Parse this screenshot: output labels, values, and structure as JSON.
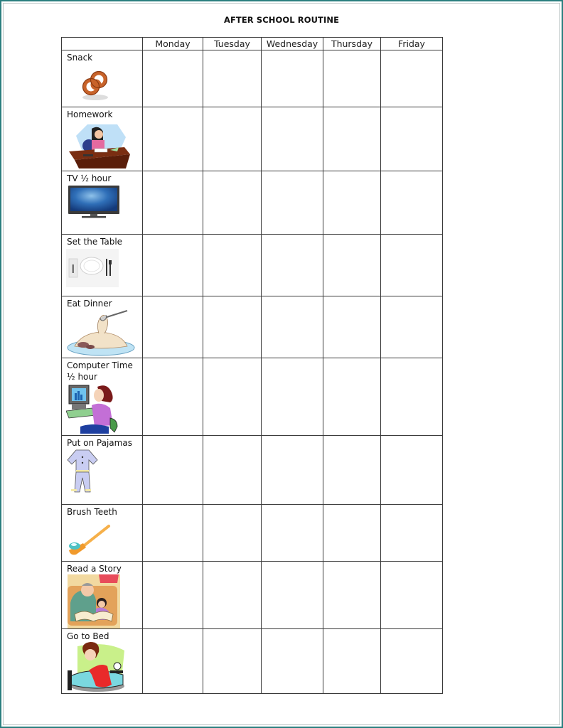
{
  "title": "AFTER SCHOOL ROUTINE",
  "colors": {
    "frame": "#2a7f7f",
    "grid": "#3a3a3a",
    "text": "#111111"
  },
  "header": {
    "corner": "",
    "days": [
      "Monday",
      "Tuesday",
      "Wednesday",
      "Thursday",
      "Friday"
    ]
  },
  "tasks": [
    {
      "label": "Snack",
      "icon": "pretzel-icon",
      "checks": [
        "",
        "",
        "",
        "",
        ""
      ]
    },
    {
      "label": "Homework",
      "icon": "student-at-desk-icon",
      "checks": [
        "",
        "",
        "",
        "",
        ""
      ]
    },
    {
      "label": "TV ½ hour",
      "icon": "television-icon",
      "checks": [
        "",
        "",
        "",
        "",
        ""
      ]
    },
    {
      "label": "Set the Table",
      "icon": "place-setting-icon",
      "checks": [
        "",
        "",
        "",
        "",
        ""
      ]
    },
    {
      "label": "Eat Dinner",
      "icon": "spaghetti-plate-icon",
      "checks": [
        "",
        "",
        "",
        "",
        ""
      ]
    },
    {
      "label": "Computer Time ½ hour",
      "icon": "girl-at-computer-icon",
      "checks": [
        "",
        "",
        "",
        "",
        ""
      ]
    },
    {
      "label": "Put on Pajamas",
      "icon": "pajamas-icon",
      "checks": [
        "",
        "",
        "",
        "",
        ""
      ]
    },
    {
      "label": "Brush Teeth",
      "icon": "toothbrush-icon",
      "checks": [
        "",
        "",
        "",
        "",
        ""
      ]
    },
    {
      "label": "Read a Story",
      "icon": "grandpa-reading-icon",
      "checks": [
        "",
        "",
        "",
        "",
        ""
      ]
    },
    {
      "label": "Go to Bed",
      "icon": "woman-in-bed-alarm-icon",
      "checks": [
        "",
        "",
        "",
        "",
        ""
      ]
    }
  ]
}
